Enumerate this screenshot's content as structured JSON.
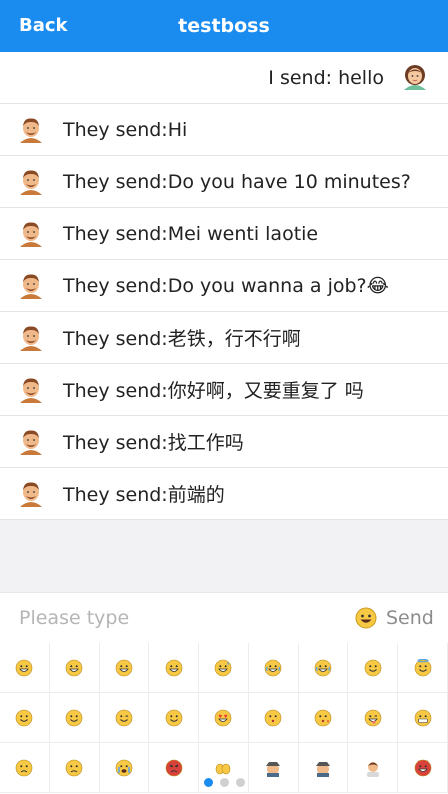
{
  "header": {
    "back_label": "Back",
    "title": "testboss"
  },
  "messages": [
    {
      "from": "me",
      "text": "I send: hello"
    },
    {
      "from": "them",
      "text": "They send:Hi"
    },
    {
      "from": "them",
      "text": "They send:Do you have 10 minutes?"
    },
    {
      "from": "them",
      "text": "They send:Mei wenti laotie"
    },
    {
      "from": "them",
      "text": "They send:Do you wanna a job?😂"
    },
    {
      "from": "them",
      "text": "They send:老铁，行不行啊"
    },
    {
      "from": "them",
      "text": "They send:你好啊，又要重复了 吗"
    },
    {
      "from": "them",
      "text": "They send:找工作吗"
    },
    {
      "from": "them",
      "text": "They send:前端的"
    }
  ],
  "input": {
    "placeholder": "Please type",
    "send_label": "Send"
  },
  "emoji_grid": [
    "grinning",
    "smile",
    "beaming",
    "squint-laugh",
    "sweat-smile",
    "tears-of-joy",
    "rofl",
    "blush",
    "halo",
    "slight-smile",
    "upside-down",
    "wink",
    "relieved",
    "heart-eyes",
    "kiss-face",
    "kissing-heart",
    "tongue-wink",
    "grimace",
    "disappointed",
    "worried",
    "crying",
    "angry",
    "hands",
    "detective",
    "detective",
    "person",
    "devil"
  ],
  "pager": {
    "pages": 3,
    "active": 0
  },
  "colors": {
    "accent": "#1a8cf0",
    "emoji_yellow": "#f7c844"
  }
}
